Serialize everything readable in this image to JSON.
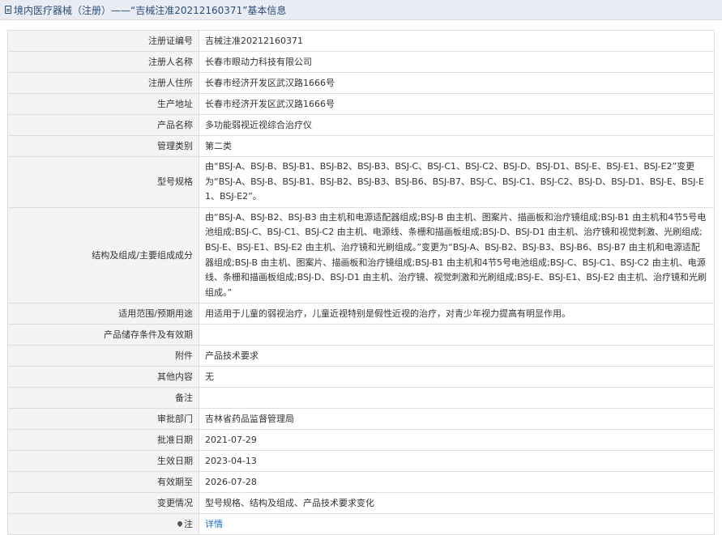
{
  "header": {
    "title": "境内医疗器械（注册）——“吉械注准20212160371”基本信息"
  },
  "rows": [
    {
      "label": "注册证编号",
      "value": "吉械注准20212160371"
    },
    {
      "label": "注册人名称",
      "value": "长春市眼动力科技有限公司"
    },
    {
      "label": "注册人住所",
      "value": "长春市经济开发区武汉路1666号"
    },
    {
      "label": "生产地址",
      "value": "长春市经济开发区武汉路1666号"
    },
    {
      "label": "产品名称",
      "value": "多功能弱视近视综合治疗仪"
    },
    {
      "label": "管理类别",
      "value": "第二类"
    },
    {
      "label": "型号规格",
      "value": "由“BSJ-A、BSJ-B、BSJ-B1、BSJ-B2、BSJ-B3、BSJ-C、BSJ-C1、BSJ-C2、BSJ-D、BSJ-D1、BSJ-E、BSJ-E1、BSJ-E2”变更为“BSJ-A、BSJ-B、BSJ-B1、BSJ-B2、BSJ-B3、BSJ-B6、BSJ-B7、BSJ-C、BSJ-C1、BSJ-C2、BSJ-D、BSJ-D1、BSJ-E、BSJ-E1、BSJ-E2”。"
    },
    {
      "label": "结构及组成/主要组成成分",
      "value": "由“BSJ-A、BSJ-B2、BSJ-B3 由主机和电源适配器组成;BSJ-B 由主机、图案片、描画板和治疗镜组成;BSJ-B1 由主机和4节5号电池组成;BSJ-C、BSJ-C1、BSJ-C2 由主机、电源线、条栅和描画板组成;BSJ-D、BSJ-D1 由主机、治疗镜和视觉刺激、光刷组成;BSJ-E、BSJ-E1、BSJ-E2 由主机、治疗镜和光刷组成。”变更为“BSJ-A、BSJ-B2、BSJ-B3、BSJ-B6、BSJ-B7 由主机和电源适配器组成;BSJ-B 由主机、图案片、描画板和治疗镜组成;BSJ-B1 由主机和4节5号电池组成;BSJ-C、BSJ-C1、BSJ-C2 由主机、电源线、条栅和描画板组成;BSJ-D、BSJ-D1 由主机、治疗镜、视觉刺激和光刷组成;BSJ-E、BSJ-E1、BSJ-E2 由主机、治疗镜和光刷组成。”"
    },
    {
      "label": "适用范围/预期用途",
      "value": "用适用于儿童的弱视治疗，儿童近视特别是假性近视的治疗，对青少年视力提高有明显作用。"
    },
    {
      "label": "产品储存条件及有效期",
      "value": ""
    },
    {
      "label": "附件",
      "value": "产品技术要求"
    },
    {
      "label": "其他内容",
      "value": "无"
    },
    {
      "label": "备注",
      "value": ""
    },
    {
      "label": "审批部门",
      "value": "吉林省药品监督管理局"
    },
    {
      "label": "批准日期",
      "value": "2021-07-29"
    },
    {
      "label": "生效日期",
      "value": "2023-04-13"
    },
    {
      "label": "有效期至",
      "value": "2026-07-28"
    },
    {
      "label": "变更情况",
      "value": "型号规格、结构及组成、产品技术要求变化"
    }
  ],
  "note_row": {
    "label": "注",
    "link_text": "详情"
  },
  "icons": {
    "header": "document-icon",
    "note": "pin-icon"
  },
  "colors": {
    "header_bg": "#e9edf3",
    "header_text": "#2b4d7a",
    "label_bg": "#f4f4f4",
    "link": "#1a6fc4"
  }
}
